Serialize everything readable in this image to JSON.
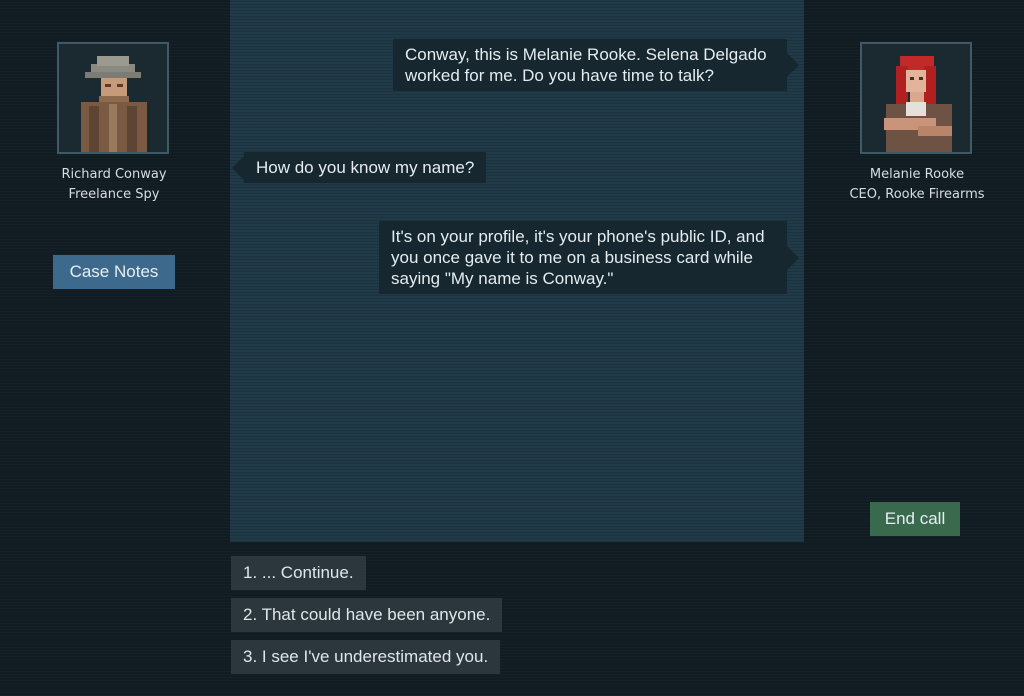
{
  "left_contact": {
    "name": "Richard Conway",
    "title": "Freelance Spy",
    "portrait_icon": "detective-portrait"
  },
  "right_contact": {
    "name": "Melanie Rooke",
    "title": "CEO, Rooke Firearms",
    "portrait_icon": "red-haired-woman-portrait"
  },
  "buttons": {
    "case_notes": "Case Notes",
    "end_call": "End call"
  },
  "messages": [
    {
      "speaker": "Melanie Rooke",
      "text": "Conway, this is Melanie Rooke. Selena Delgado worked for me. Do you have time to talk?"
    },
    {
      "speaker": "Richard Conway",
      "text": "How do you know my name?"
    },
    {
      "speaker": "Melanie Rooke",
      "text": "It's on your profile, it's your phone's public ID, and you once gave it to me on a business card while saying \"My name is Conway.\""
    }
  ],
  "choices": [
    {
      "label": "1. ... Continue."
    },
    {
      "label": "2. That could have been anyone."
    },
    {
      "label": "3. I see I've underestimated you."
    }
  ],
  "colors": {
    "panel": "#203a48",
    "background": "#111b22",
    "case_notes_button": "#3d6a8c",
    "end_call_button": "#3a6a4e"
  }
}
